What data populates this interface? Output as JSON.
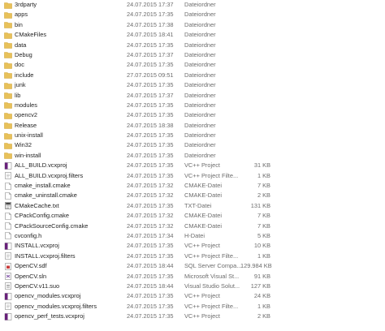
{
  "files": [
    {
      "name": "3rdparty",
      "date": "24.07.2015 17:37",
      "type": "Dateiordner",
      "size": "",
      "icon": "folder-icon"
    },
    {
      "name": "apps",
      "date": "24.07.2015 17:35",
      "type": "Dateiordner",
      "size": "",
      "icon": "folder-icon"
    },
    {
      "name": "bin",
      "date": "24.07.2015 17:38",
      "type": "Dateiordner",
      "size": "",
      "icon": "folder-icon"
    },
    {
      "name": "CMakeFiles",
      "date": "24.07.2015 18:41",
      "type": "Dateiordner",
      "size": "",
      "icon": "folder-icon"
    },
    {
      "name": "data",
      "date": "24.07.2015 17:35",
      "type": "Dateiordner",
      "size": "",
      "icon": "folder-icon"
    },
    {
      "name": "Debug",
      "date": "24.07.2015 17:37",
      "type": "Dateiordner",
      "size": "",
      "icon": "folder-icon"
    },
    {
      "name": "doc",
      "date": "24.07.2015 17:35",
      "type": "Dateiordner",
      "size": "",
      "icon": "folder-icon"
    },
    {
      "name": "include",
      "date": "27.07.2015 09:51",
      "type": "Dateiordner",
      "size": "",
      "icon": "folder-icon"
    },
    {
      "name": "junk",
      "date": "24.07.2015 17:35",
      "type": "Dateiordner",
      "size": "",
      "icon": "folder-icon"
    },
    {
      "name": "lib",
      "date": "24.07.2015 17:37",
      "type": "Dateiordner",
      "size": "",
      "icon": "folder-icon"
    },
    {
      "name": "modules",
      "date": "24.07.2015 17:35",
      "type": "Dateiordner",
      "size": "",
      "icon": "folder-icon"
    },
    {
      "name": "opencv2",
      "date": "24.07.2015 17:35",
      "type": "Dateiordner",
      "size": "",
      "icon": "folder-icon"
    },
    {
      "name": "Release",
      "date": "24.07.2015 18:38",
      "type": "Dateiordner",
      "size": "",
      "icon": "folder-icon"
    },
    {
      "name": "unix-install",
      "date": "24.07.2015 17:35",
      "type": "Dateiordner",
      "size": "",
      "icon": "folder-icon"
    },
    {
      "name": "Win32",
      "date": "24.07.2015 17:35",
      "type": "Dateiordner",
      "size": "",
      "icon": "folder-icon"
    },
    {
      "name": "win-install",
      "date": "24.07.2015 17:35",
      "type": "Dateiordner",
      "size": "",
      "icon": "folder-icon"
    },
    {
      "name": "ALL_BUILD.vcxproj",
      "date": "24.07.2015 17:35",
      "type": "VC++ Project",
      "size": "31 KB",
      "icon": "vcxproj-file-icon"
    },
    {
      "name": "ALL_BUILD.vcxproj.filters",
      "date": "24.07.2015 17:35",
      "type": "VC++ Project Filte...",
      "size": "1 KB",
      "icon": "filters-file-icon"
    },
    {
      "name": "cmake_install.cmake",
      "date": "24.07.2015 17:32",
      "type": "CMAKE-Datei",
      "size": "7 KB",
      "icon": "generic-file-icon"
    },
    {
      "name": "cmake_uninstall.cmake",
      "date": "24.07.2015 17:32",
      "type": "CMAKE-Datei",
      "size": "2 KB",
      "icon": "generic-file-icon"
    },
    {
      "name": "CMakeCache.txt",
      "date": "24.07.2015 17:35",
      "type": "TXT-Datei",
      "size": "131 KB",
      "icon": "text-file-icon"
    },
    {
      "name": "CPackConfig.cmake",
      "date": "24.07.2015 17:32",
      "type": "CMAKE-Datei",
      "size": "7 KB",
      "icon": "generic-file-icon"
    },
    {
      "name": "CPackSourceConfig.cmake",
      "date": "24.07.2015 17:32",
      "type": "CMAKE-Datei",
      "size": "7 KB",
      "icon": "generic-file-icon"
    },
    {
      "name": "cvconfig.h",
      "date": "24.07.2015 17:34",
      "type": "H-Datei",
      "size": "5 KB",
      "icon": "generic-file-icon"
    },
    {
      "name": "INSTALL.vcxproj",
      "date": "24.07.2015 17:35",
      "type": "VC++ Project",
      "size": "10 KB",
      "icon": "vcxproj-file-icon"
    },
    {
      "name": "INSTALL.vcxproj.filters",
      "date": "24.07.2015 17:35",
      "type": "VC++ Project Filte...",
      "size": "1 KB",
      "icon": "filters-file-icon"
    },
    {
      "name": "OpenCV.sdf",
      "date": "24.07.2015 18:44",
      "type": "SQL Server Compa...",
      "size": "129.984 KB",
      "icon": "sdf-file-icon"
    },
    {
      "name": "OpenCV.sln",
      "date": "24.07.2015 17:35",
      "type": "Microsoft Visual St...",
      "size": "91 KB",
      "icon": "sln-file-icon"
    },
    {
      "name": "OpenCV.v11.suo",
      "date": "24.07.2015 18:44",
      "type": "Visual Studio Solut...",
      "size": "127 KB",
      "icon": "suo-file-icon"
    },
    {
      "name": "opencv_modules.vcxproj",
      "date": "24.07.2015 17:35",
      "type": "VC++ Project",
      "size": "24 KB",
      "icon": "vcxproj-file-icon"
    },
    {
      "name": "opencv_modules.vcxproj.filters",
      "date": "24.07.2015 17:35",
      "type": "VC++ Project Filte...",
      "size": "1 KB",
      "icon": "filters-file-icon"
    },
    {
      "name": "opencv_perf_tests.vcxproj",
      "date": "24.07.2015 17:35",
      "type": "VC++ Project",
      "size": "2 KB",
      "icon": "vcxproj-file-icon"
    }
  ],
  "colors": {
    "folder": "#e8c15a",
    "folder_dark": "#d4a93c",
    "vcxproj": "#68217a",
    "text_secondary": "#6d6d6d"
  }
}
